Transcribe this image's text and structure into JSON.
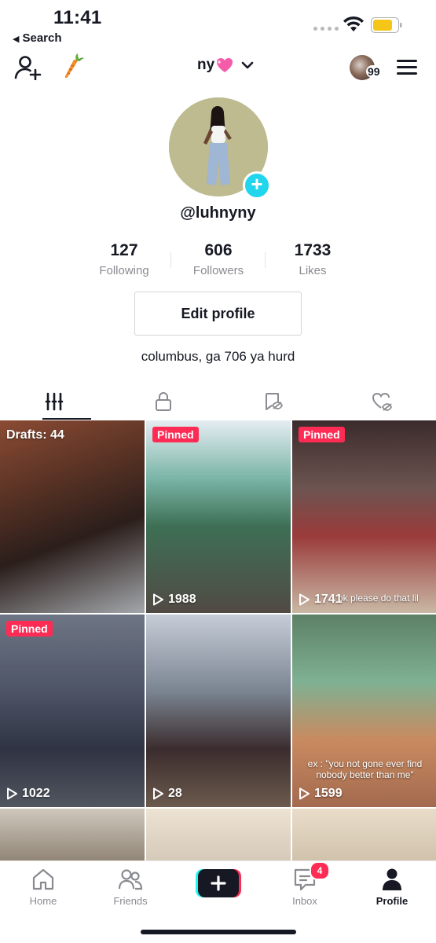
{
  "status_bar": {
    "time": "11:41",
    "back_label": "Search",
    "back_icon": "back-triangle"
  },
  "top_nav": {
    "title": "ny",
    "title_emoji": "sparkling-heart-emoji",
    "notification_count": "99",
    "icons": [
      "add-user-icon",
      "carrot-icon",
      "chevron-down-icon",
      "avatar",
      "menu-icon"
    ]
  },
  "profile": {
    "handle": "@luhnyny",
    "stats": [
      {
        "value": "127",
        "label": "Following"
      },
      {
        "value": "606",
        "label": "Followers"
      },
      {
        "value": "1733",
        "label": "Likes"
      }
    ],
    "edit_label": "Edit profile",
    "bio": "columbus, ga 706 ya hurd"
  },
  "tabs": [
    {
      "name": "videos",
      "icon": "grid-lines-icon",
      "active": true
    },
    {
      "name": "private",
      "icon": "lock-icon",
      "active": false
    },
    {
      "name": "favorites",
      "icon": "bookmark-hidden-icon",
      "active": false
    },
    {
      "name": "liked",
      "icon": "heart-hidden-icon",
      "active": false
    }
  ],
  "videos": [
    {
      "label": "Drafts: 44",
      "pinned": false,
      "views": ""
    },
    {
      "label": "Pinned",
      "pinned": true,
      "views": "1988"
    },
    {
      "label": "Pinned",
      "pinned": true,
      "views": "1741",
      "caption": "ok please do that lil"
    },
    {
      "label": "Pinned",
      "pinned": true,
      "views": "1022"
    },
    {
      "label": "",
      "pinned": false,
      "views": "28"
    },
    {
      "label": "",
      "pinned": false,
      "views": "1599",
      "caption": "ex : \"you not gone ever find nobody better than me\""
    }
  ],
  "bottom_nav": {
    "items": [
      {
        "label": "Home",
        "icon": "home-icon"
      },
      {
        "label": "Friends",
        "icon": "friends-icon"
      },
      {
        "label": "",
        "icon": "create-plus-icon"
      },
      {
        "label": "Inbox",
        "icon": "inbox-icon"
      },
      {
        "label": "Profile",
        "icon": "profile-icon"
      }
    ],
    "inbox_badge": "4"
  },
  "colors": {
    "accent_red": "#fe2c55",
    "accent_cyan": "#20d5ec",
    "text_primary": "#161823",
    "text_secondary": "#8a8b91"
  }
}
